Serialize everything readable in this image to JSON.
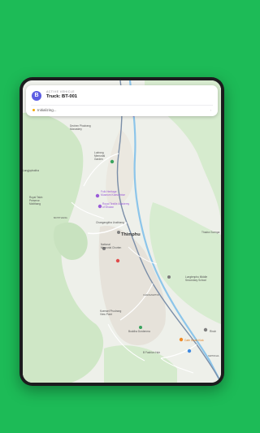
{
  "vehicle_card": {
    "avatar_letter": "B",
    "label": "ACTIVE VEHICLE",
    "truck_name": "Truck: BT-001",
    "status": "Initializing..."
  },
  "map": {
    "labels": {
      "dechen": [
        "Dechen Phodrang",
        "Monastery"
      ],
      "ludrong": [
        "Ludrong",
        "Memorial",
        "Garden"
      ],
      "langjo": "Langjophakha",
      "folk": [
        "Folk Heritage",
        "Museum Kaesumtse"
      ],
      "textile": [
        "Royal Textile Academy",
        "of Bhutan"
      ],
      "royal_takin": [
        "Royal Takin",
        "Preserve",
        "Motithang"
      ],
      "motithang": "MOTITHANG",
      "changang": "Changangkha Lhakhang",
      "thimphu": "Thimphu",
      "national_memorial": [
        "National",
        "Memorial Chorten"
      ],
      "luntenzampa": "Lungtenphu Middle",
      "secondary": "Secondary School",
      "thadra": "Thadra Goenpa",
      "kuensel": [
        "Kuensel Phodrang",
        "View Point"
      ],
      "buddha": "Buddha Dordenma",
      "cafe": "Cafe South Kick",
      "fashion": "B Fashion Hub",
      "changzamtok": "CHANGZAMTOK",
      "simtokha": "SIMTOKHA",
      "rinchen": "Rinch",
      "top_poi": "Tashichho Dzong"
    }
  },
  "colors": {
    "background": "#1dbb57",
    "avatar": "#5b5ce2",
    "status_dot": "#f2a900",
    "river": "#8cc5ea",
    "road": "#7a8ea8"
  }
}
